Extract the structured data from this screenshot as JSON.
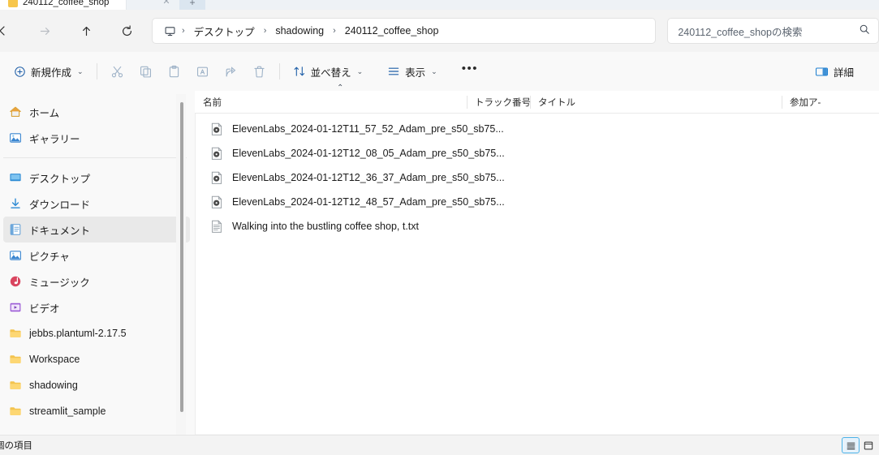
{
  "window": {
    "tab_title": "240112_coffee_shop",
    "tab_close_glyph": "✕",
    "new_tab_glyph": "+"
  },
  "nav": {
    "back_label": "戻る",
    "forward_label": "進む",
    "up_label": "上へ",
    "refresh_label": "更新"
  },
  "breadcrumb": {
    "separator": "›",
    "items": [
      {
        "label": "デスクトップ"
      },
      {
        "label": "shadowing"
      },
      {
        "label": "240112_coffee_shop"
      }
    ]
  },
  "search": {
    "placeholder": "240112_coffee_shopの検索"
  },
  "toolbar": {
    "new_label": "新規作成",
    "chevron": "⌄",
    "cut_label": "切り取り",
    "copy_label": "コピー",
    "paste_label": "貼り付け",
    "rename_label": "名前の変更",
    "share_label": "共有",
    "delete_label": "削除",
    "sort_label": "並べ替え",
    "view_label": "表示",
    "more_label": "もっと見る",
    "more_glyph": "•••",
    "details_label": "詳細"
  },
  "sidebar": {
    "groups": [
      {
        "items": [
          {
            "label": "ホーム",
            "icon": "home-icon",
            "pinned": false,
            "selected": false
          },
          {
            "label": "ギャラリー",
            "icon": "gallery-icon",
            "pinned": false,
            "selected": false
          }
        ]
      },
      {
        "items": [
          {
            "label": "デスクトップ",
            "icon": "desktop-icon",
            "pinned": true,
            "selected": false
          },
          {
            "label": "ダウンロード",
            "icon": "download-icon",
            "pinned": true,
            "selected": false
          },
          {
            "label": "ドキュメント",
            "icon": "documents-icon",
            "pinned": true,
            "selected": true
          },
          {
            "label": "ピクチャ",
            "icon": "pictures-icon",
            "pinned": true,
            "selected": false
          },
          {
            "label": "ミュージック",
            "icon": "music-icon",
            "pinned": true,
            "selected": false
          },
          {
            "label": "ビデオ",
            "icon": "videos-icon",
            "pinned": true,
            "selected": false
          },
          {
            "label": "jebbs.plantuml-2.17.5",
            "icon": "folder-icon",
            "pinned": true,
            "selected": false
          },
          {
            "label": "Workspace",
            "icon": "folder-icon",
            "pinned": true,
            "selected": false
          },
          {
            "label": "shadowing",
            "icon": "folder-icon",
            "pinned": false,
            "selected": false
          },
          {
            "label": "streamlit_sample",
            "icon": "folder-icon",
            "pinned": false,
            "selected": false
          }
        ]
      }
    ],
    "pin_glyph": "📌"
  },
  "filelist": {
    "columns": [
      {
        "label": "名前",
        "sorted": "asc",
        "sort_glyph": "⌃"
      },
      {
        "label": "トラック番号",
        "sorted": ""
      },
      {
        "label": "タイトル",
        "sorted": ""
      },
      {
        "label": "参加ア-",
        "sorted": ""
      }
    ],
    "rows": [
      {
        "name": "ElevenLabs_2024-01-12T11_57_52_Adam_pre_s50_sb75...",
        "icon": "audio-file-icon",
        "track": "",
        "title": "",
        "artist": ""
      },
      {
        "name": "ElevenLabs_2024-01-12T12_08_05_Adam_pre_s50_sb75...",
        "icon": "audio-file-icon",
        "track": "",
        "title": "",
        "artist": ""
      },
      {
        "name": "ElevenLabs_2024-01-12T12_36_37_Adam_pre_s50_sb75...",
        "icon": "audio-file-icon",
        "track": "",
        "title": "",
        "artist": ""
      },
      {
        "name": "ElevenLabs_2024-01-12T12_48_57_Adam_pre_s50_sb75...",
        "icon": "audio-file-icon",
        "track": "",
        "title": "",
        "artist": ""
      },
      {
        "name": "Walking into the bustling coffee shop, t.txt",
        "icon": "text-file-icon",
        "track": "",
        "title": "",
        "artist": ""
      }
    ]
  },
  "statusbar": {
    "item_count_text": "個の項目",
    "details_view_label": "詳細表示",
    "icons_view_label": "大アイコン表示"
  },
  "colors": {
    "accent": "#1f7fd0",
    "selection": "#e9e9e9",
    "folder": "#f7c64b",
    "window_bg": "#f9f9f9",
    "chrome_bg": "#f3f3f3",
    "pane_bg": "#ffffff"
  }
}
